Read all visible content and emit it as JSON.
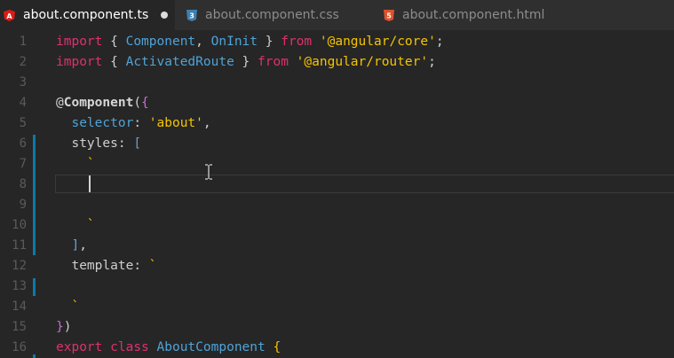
{
  "tabs": [
    {
      "label": "about.component.ts",
      "icon": "angular-icon",
      "active": true,
      "dirty": true
    },
    {
      "label": "about.component.css",
      "icon": "css3-icon",
      "active": false
    },
    {
      "label": "about.component.html",
      "icon": "html5-icon",
      "active": false
    }
  ],
  "editor": {
    "line_numbers": [
      "1",
      "2",
      "3",
      "4",
      "5",
      "6",
      "7",
      "8",
      "9",
      "10",
      "11",
      "12",
      "13",
      "14",
      "15",
      "16"
    ],
    "current_line": 8,
    "code": {
      "l1": {
        "kw1": "import",
        "p1": " { ",
        "id1": "Component",
        "p2": ", ",
        "id2": "OnInit",
        "p3": " } ",
        "kw2": "from",
        "sp": " ",
        "str": "'@angular/core'",
        "end": ";"
      },
      "l2": {
        "kw1": "import",
        "p1": " { ",
        "id1": "ActivatedRoute",
        "p2": " } ",
        "kw2": "from",
        "sp": " ",
        "str": "'@angular/router'",
        "end": ";"
      },
      "l4": {
        "at": "@",
        "dec": "Component",
        "p": "(",
        "br": "{"
      },
      "l5": {
        "ind": "  ",
        "prop": "selector",
        "colon": ": ",
        "str": "'about'",
        "end": ","
      },
      "l6": {
        "ind": "  ",
        "prop": "styles",
        "colon": ": ",
        "br": "["
      },
      "l7": {
        "ind": "    ",
        "tick": "`"
      },
      "l10": {
        "ind": "    ",
        "tick": "`"
      },
      "l11": {
        "ind": "  ",
        "br": "]",
        "end": ","
      },
      "l12": {
        "ind": "  ",
        "prop": "template",
        "colon": ": ",
        "tick": "`"
      },
      "l14": {
        "ind": "  ",
        "tick": "`"
      },
      "l15": {
        "br": "}",
        "p": ")"
      },
      "l16": {
        "kw1": "export",
        "sp1": " ",
        "kw2": "class",
        "sp2": " ",
        "id": "AboutComponent",
        "sp3": " ",
        "br": "{"
      }
    }
  },
  "colors": {
    "keyword": "#e0306f",
    "identifier": "#4ea3d8",
    "string": "#f4c400",
    "bracket": "#c86bd8",
    "background": "#262626",
    "gutter_mark": "#0c7aa6"
  }
}
